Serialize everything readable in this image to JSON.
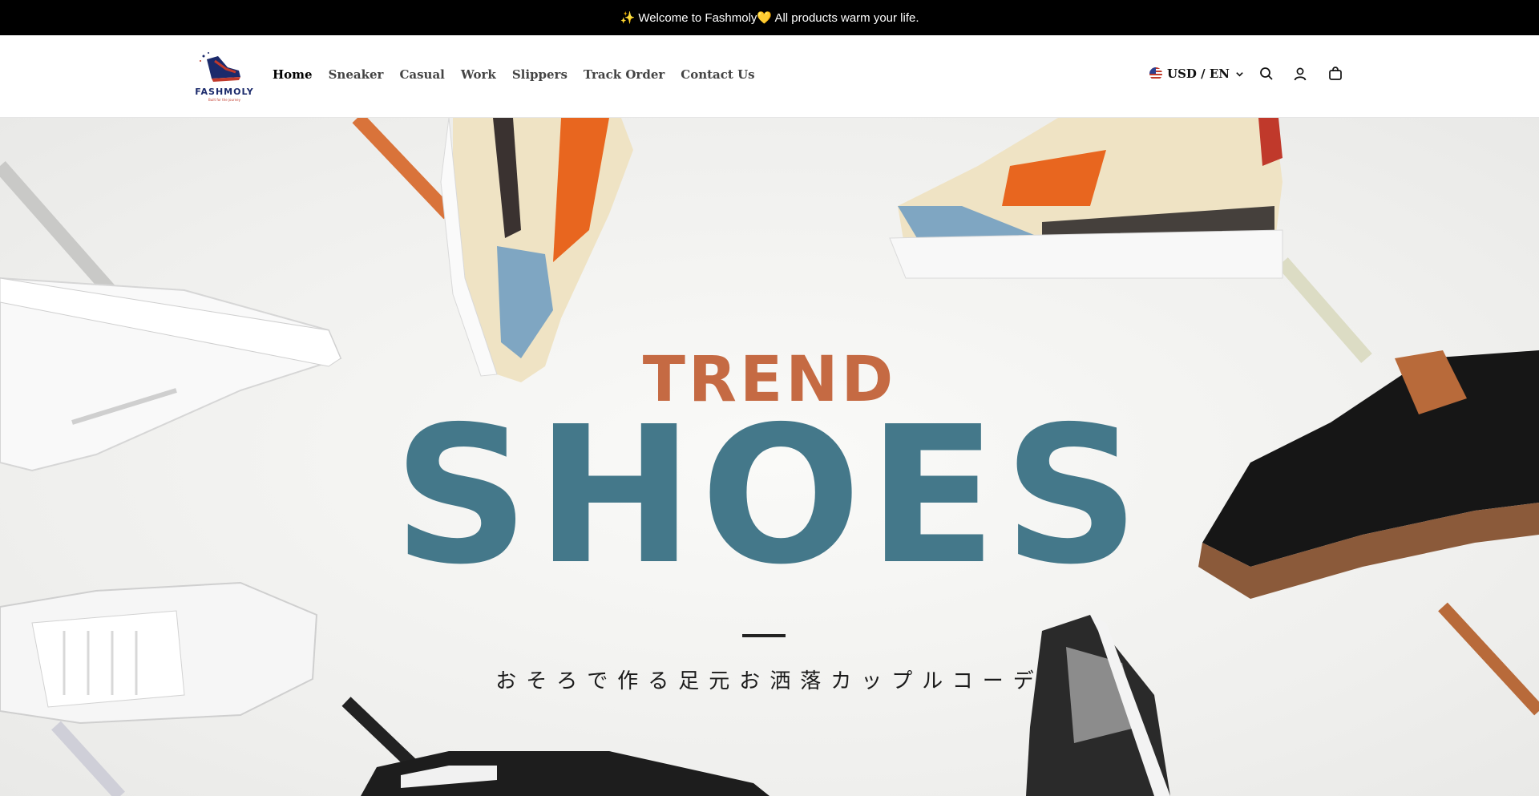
{
  "announcement": {
    "text": "✨ Welcome to Fashmoly💛 All products warm your life."
  },
  "brand": {
    "name": "FASHMOLY",
    "tagline": "Built for the journey"
  },
  "nav": {
    "items": [
      {
        "label": "Home",
        "active": true
      },
      {
        "label": "Sneaker"
      },
      {
        "label": "Casual"
      },
      {
        "label": "Work"
      },
      {
        "label": "Slippers"
      },
      {
        "label": "Track Order"
      },
      {
        "label": "Contact Us"
      }
    ]
  },
  "tools": {
    "locale": "USD / EN",
    "flag_icon": "us-flag-icon",
    "icons": [
      "chevron-down-icon",
      "search-icon",
      "account-icon",
      "cart-icon"
    ]
  },
  "hero": {
    "eyebrow": "TREND",
    "title": "SHOES",
    "subtitle": "おそろで作る足元お洒落カップルコーデ"
  },
  "colors": {
    "trend": "#c56a43",
    "shoes": "#44788a",
    "bar": "#000000"
  }
}
